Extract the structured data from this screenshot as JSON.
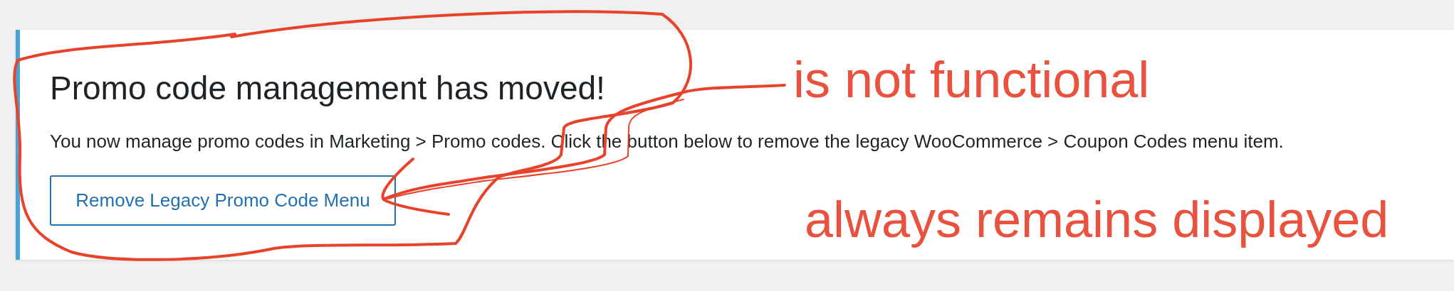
{
  "notice": {
    "title": "Promo code management has moved!",
    "message": "You now manage promo codes in Marketing > Promo codes. Click the button below to remove the legacy WooCommerce > Coupon Codes menu item.",
    "button": "Remove Legacy Promo Code Menu"
  },
  "annotations": [
    "is not functional",
    "always remains displayed"
  ]
}
